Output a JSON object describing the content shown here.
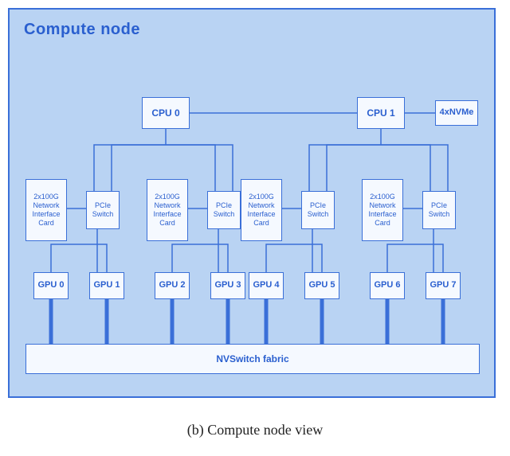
{
  "panel": {
    "title": "Compute node"
  },
  "cpus": [
    "CPU 0",
    "CPU 1"
  ],
  "nvme": "4xNVMe",
  "nic_label": "2x100G Network Interface Card",
  "pcie_label": "PCIe Switch",
  "gpus": [
    "GPU 0",
    "GPU 1",
    "GPU 2",
    "GPU 3",
    "GPU 4",
    "GPU 5",
    "GPU 6",
    "GPU 7"
  ],
  "fabric": "NVSwitch fabric",
  "caption": "(b) Compute node view",
  "colors": {
    "panel_bg": "#b9d3f3",
    "panel_border": "#3a6fd8",
    "box_bg": "#f5f9ff",
    "box_border": "#3a6fd8",
    "text": "#2a5fcf"
  }
}
